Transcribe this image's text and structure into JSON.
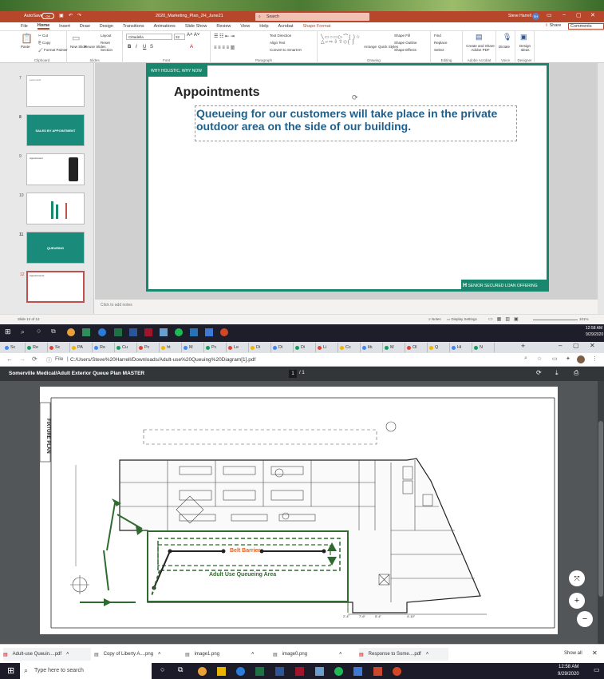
{
  "ppt": {
    "autosave": "AutoSave",
    "autosave_state": "Off",
    "filename": "2020_Marketing_Plan_2H_June21",
    "search_placeholder": "Search",
    "user": "Steve Harrell",
    "user_initials": "SH",
    "share": "Share",
    "comments": "Comments",
    "menu": [
      "File",
      "Home",
      "Insert",
      "Draw",
      "Design",
      "Transitions",
      "Animations",
      "Slide Show",
      "Review",
      "View",
      "Help",
      "Acrobat",
      "Shape Format"
    ],
    "ribbon": {
      "paste": "Paste",
      "cut": "Cut",
      "copy": "Copy",
      "format_painter": "Format Painter",
      "clipboard": "Clipboard",
      "new_slide": "New Slide",
      "reuse_slides": "Reuse Slides",
      "layout": "Layout",
      "reset": "Reset",
      "section": "Section",
      "slides": "Slides",
      "font_name": "Cittadella",
      "font_size": "32",
      "font": "Font",
      "paragraph": "Paragraph",
      "text_direction": "Text Direction",
      "align_text": "Align Text",
      "convert_smartart": "Convert to SmartArt",
      "drawing": "Drawing",
      "arrange": "Arrange",
      "quick_styles": "Quick Styles",
      "shape_fill": "Shape Fill",
      "shape_outline": "Shape Outline",
      "shape_effects": "Shape Effects",
      "find": "Find",
      "replace": "Replace",
      "select": "Select",
      "editing": "Editing",
      "create_share": "Create and Share Adobe PDF",
      "adobe_acrobat": "Adobe Acrobat",
      "dictate": "Dictate",
      "voice": "Voice",
      "design_ideas": "Design Ideas",
      "designer": "Designer"
    },
    "thumbs": [
      {
        "num": "7",
        "text": "Lorem text"
      },
      {
        "num": "8",
        "text": "SALES BY APPOINTMENT"
      },
      {
        "num": "9",
        "text": "Appointment"
      },
      {
        "num": "10",
        "text": ""
      },
      {
        "num": "11",
        "text": "QUEUEING"
      },
      {
        "num": "12",
        "text": "Appointments"
      }
    ],
    "slide": {
      "banner": "WHY HOLISTIC, WHY NOW",
      "title": "Appointments",
      "body": "Queueing for our customers will take place in the private outdoor area on the side of our building.",
      "footer": "SENIOR SECURED LOAN OFFERING",
      "footer_logo": "H"
    },
    "notes_placeholder": "Click to add notes",
    "status": {
      "slide": "Slide 12 of 12",
      "notes": "Notes",
      "display_settings": "Display Settings",
      "zoom": "101%"
    }
  },
  "taskbar_top": {
    "time": "12:58 AM",
    "date": "9/29/2020"
  },
  "chrome": {
    "address": "C:/Users/Steve%20Harrell/Downloads/Adult-use%20Queuing%20Diagram[1].pdf",
    "file_label": "File",
    "pdf_title": "Somerville Medical/Adult Exterior Queue Plan MASTER",
    "page_current": "1",
    "page_total": "/ 1",
    "tab_labels": [
      "Sc",
      "Re",
      "Sc",
      "PA",
      "Re",
      "Cu",
      "Pc",
      "ht",
      "M",
      "Pc",
      "Le",
      "Di",
      "Di",
      "Di",
      "Li",
      "Cc",
      "lib",
      "M",
      "Ol",
      "Q",
      "Hi",
      "N"
    ]
  },
  "plan": {
    "side_label": "FIXTURE PLAN",
    "belt_barrier": "Belt Barrier",
    "queue_area": "Adult Use Queueing Area",
    "dims": [
      "2'-4\"",
      "7'-6\"",
      "5'-4\"",
      "4'-10\""
    ],
    "colors": {
      "green": "#2f6b2f",
      "orange": "#e06020"
    }
  },
  "downloads": {
    "items": [
      "Adult-use Queuin....pdf",
      "Copy of Liberty A....png",
      "image1.png",
      "image0.png",
      "Response to Some....pdf"
    ],
    "show_all": "Show all"
  },
  "taskbar": {
    "search_placeholder": "Type here to search",
    "time": "12:58 AM",
    "date": "9/29/2020"
  }
}
